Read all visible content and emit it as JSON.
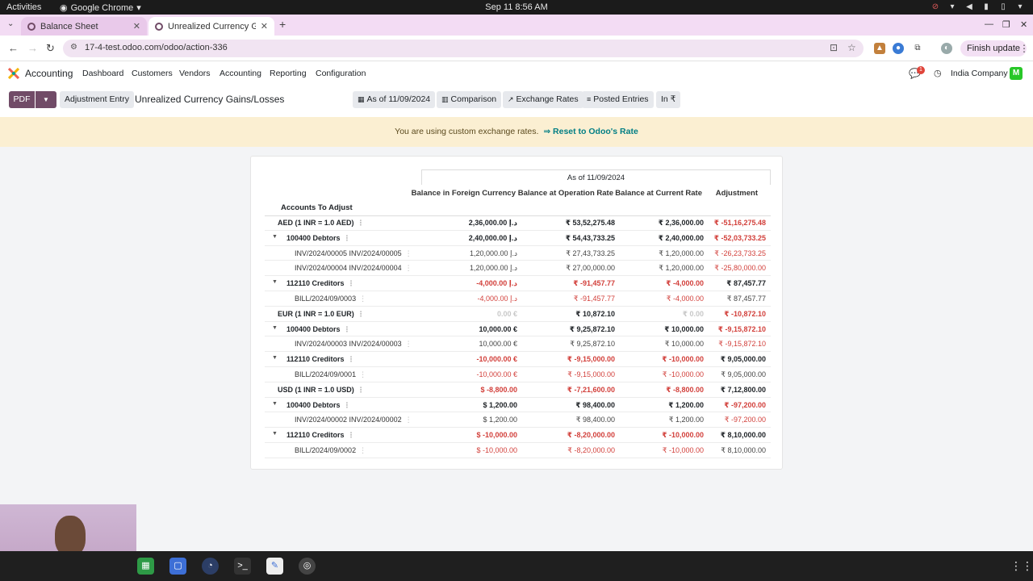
{
  "system": {
    "activities": "Activities",
    "app_name": "Google Chrome",
    "clock": "Sep 11  8:56 AM"
  },
  "browser": {
    "tabs": [
      {
        "title": "Balance Sheet"
      },
      {
        "title": "Unrealized Currency Gains/Losses"
      }
    ],
    "url": "17-4-test.odoo.com/odoo/action-336",
    "finish_update": "Finish update"
  },
  "odoo": {
    "app_name": "Accounting",
    "menu": [
      "Dashboard",
      "Customers",
      "Vendors",
      "Accounting",
      "Reporting",
      "Configuration"
    ],
    "company": "India Company",
    "avatar_letter": "M",
    "message_count": "1"
  },
  "control_panel": {
    "pdf_label": "PDF",
    "adjustment_entry_label": "Adjustment Entry",
    "title": "Unrealized Currency Gains/Losses",
    "filters": [
      {
        "icon": "calendar-icon",
        "label": "As of 11/09/2024"
      },
      {
        "icon": "bar-chart-icon",
        "label": "Comparison"
      },
      {
        "icon": "line-chart-icon",
        "label": "Exchange Rates"
      },
      {
        "icon": "sliders-icon",
        "label": "Posted Entries"
      },
      {
        "icon": "",
        "label": "In ₹"
      }
    ]
  },
  "banner": {
    "text": "You are using custom exchange rates.",
    "link": "⇒ Reset to Odoo's Rate"
  },
  "report": {
    "period": "As of 11/09/2024",
    "accounts_header": "Accounts To Adjust",
    "columns": [
      "Balance in Foreign Currency",
      "Balance at Operation Rate",
      "Balance at Current Rate",
      "Adjustment"
    ],
    "rows": [
      {
        "level": 0,
        "label": "AED (1 INR = 1.0 AED)",
        "values": [
          "2,36,000.00 د.إ",
          "₹ 53,52,275.48",
          "₹ 2,36,000.00",
          "₹ -51,16,275.48"
        ],
        "signs": [
          "pos",
          "pos",
          "pos",
          "neg"
        ]
      },
      {
        "level": 1,
        "label": "100400 Debtors",
        "values": [
          "2,40,000.00 د.إ",
          "₹ 54,43,733.25",
          "₹ 2,40,000.00",
          "₹ -52,03,733.25"
        ],
        "signs": [
          "pos",
          "pos",
          "pos",
          "neg"
        ]
      },
      {
        "level": 2,
        "label": "INV/2024/00005 INV/2024/00005",
        "values": [
          "1,20,000.00 د.إ",
          "₹ 27,43,733.25",
          "₹ 1,20,000.00",
          "₹ -26,23,733.25"
        ],
        "signs": [
          "pos",
          "pos",
          "pos",
          "neg"
        ]
      },
      {
        "level": 2,
        "label": "INV/2024/00004 INV/2024/00004",
        "values": [
          "1,20,000.00 د.إ",
          "₹ 27,00,000.00",
          "₹ 1,20,000.00",
          "₹ -25,80,000.00"
        ],
        "signs": [
          "pos",
          "pos",
          "pos",
          "neg"
        ]
      },
      {
        "level": 1,
        "label": "112110 Creditors",
        "values": [
          "-4,000.00 د.إ",
          "₹ -91,457.77",
          "₹ -4,000.00",
          "₹ 87,457.77"
        ],
        "signs": [
          "neg",
          "neg",
          "neg",
          "pos"
        ]
      },
      {
        "level": 2,
        "label": "BILL/2024/09/0003",
        "values": [
          "-4,000.00 د.إ",
          "₹ -91,457.77",
          "₹ -4,000.00",
          "₹ 87,457.77"
        ],
        "signs": [
          "neg",
          "neg",
          "neg",
          "pos"
        ]
      },
      {
        "level": 0,
        "label": "EUR (1 INR = 1.0 EUR)",
        "values": [
          "0.00 €",
          "₹ 10,872.10",
          "₹ 0.00",
          "₹ -10,872.10"
        ],
        "signs": [
          "zero",
          "pos",
          "zero",
          "neg"
        ]
      },
      {
        "level": 1,
        "label": "100400 Debtors",
        "values": [
          "10,000.00 €",
          "₹ 9,25,872.10",
          "₹ 10,000.00",
          "₹ -9,15,872.10"
        ],
        "signs": [
          "pos",
          "pos",
          "pos",
          "neg"
        ]
      },
      {
        "level": 2,
        "label": "INV/2024/00003 INV/2024/00003",
        "values": [
          "10,000.00 €",
          "₹ 9,25,872.10",
          "₹ 10,000.00",
          "₹ -9,15,872.10"
        ],
        "signs": [
          "pos",
          "pos",
          "pos",
          "neg"
        ]
      },
      {
        "level": 1,
        "label": "112110 Creditors",
        "values": [
          "-10,000.00 €",
          "₹ -9,15,000.00",
          "₹ -10,000.00",
          "₹ 9,05,000.00"
        ],
        "signs": [
          "neg",
          "neg",
          "neg",
          "pos"
        ]
      },
      {
        "level": 2,
        "label": "BILL/2024/09/0001",
        "values": [
          "-10,000.00 €",
          "₹ -9,15,000.00",
          "₹ -10,000.00",
          "₹ 9,05,000.00"
        ],
        "signs": [
          "neg",
          "neg",
          "neg",
          "pos"
        ]
      },
      {
        "level": 0,
        "label": "USD (1 INR = 1.0 USD)",
        "values": [
          "$ -8,800.00",
          "₹ -7,21,600.00",
          "₹ -8,800.00",
          "₹ 7,12,800.00"
        ],
        "signs": [
          "neg",
          "neg",
          "neg",
          "pos"
        ]
      },
      {
        "level": 1,
        "label": "100400 Debtors",
        "values": [
          "$ 1,200.00",
          "₹ 98,400.00",
          "₹ 1,200.00",
          "₹ -97,200.00"
        ],
        "signs": [
          "pos",
          "pos",
          "pos",
          "neg"
        ]
      },
      {
        "level": 2,
        "label": "INV/2024/00002 INV/2024/00002",
        "values": [
          "$ 1,200.00",
          "₹ 98,400.00",
          "₹ 1,200.00",
          "₹ -97,200.00"
        ],
        "signs": [
          "pos",
          "pos",
          "pos",
          "neg"
        ]
      },
      {
        "level": 1,
        "label": "112110 Creditors",
        "values": [
          "$ -10,000.00",
          "₹ -8,20,000.00",
          "₹ -10,000.00",
          "₹ 8,10,000.00"
        ],
        "signs": [
          "neg",
          "neg",
          "neg",
          "pos"
        ]
      },
      {
        "level": 2,
        "label": "BILL/2024/09/0002",
        "values": [
          "$ -10,000.00",
          "₹ -8,20,000.00",
          "₹ -10,000.00",
          "₹ 8,10,000.00"
        ],
        "signs": [
          "neg",
          "neg",
          "neg",
          "pos"
        ]
      }
    ]
  },
  "colors": {
    "brand": "#714b67",
    "negative": "#d23f3a",
    "banner_bg": "#fbefd2",
    "link": "#017e84"
  }
}
